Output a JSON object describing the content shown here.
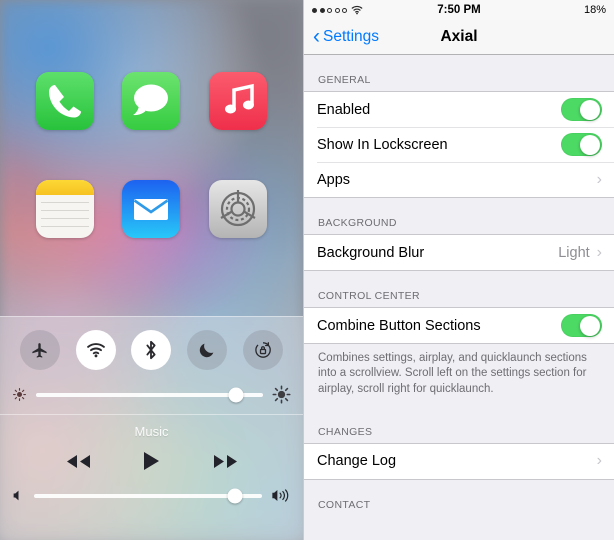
{
  "left_screen": {
    "name": "ios-home-screen",
    "apps": [
      {
        "name": "phone-app-icon",
        "label": "Phone"
      },
      {
        "name": "messages-app-icon",
        "label": "Messages"
      },
      {
        "name": "music-app-icon",
        "label": "Music"
      },
      {
        "name": "notes-app-icon",
        "label": "Notes"
      },
      {
        "name": "mail-app-icon",
        "label": "Mail"
      },
      {
        "name": "settings-app-icon",
        "label": "Settings"
      }
    ],
    "control_center": {
      "toggles": [
        {
          "name": "airplane-mode-toggle",
          "label": "Airplane Mode",
          "active": false
        },
        {
          "name": "wifi-toggle",
          "label": "Wi-Fi",
          "active": true
        },
        {
          "name": "bluetooth-toggle",
          "label": "Bluetooth",
          "active": true
        },
        {
          "name": "do-not-disturb-toggle",
          "label": "Do Not Disturb",
          "active": false
        },
        {
          "name": "rotation-lock-toggle",
          "label": "Rotation Lock",
          "active": false
        }
      ],
      "brightness": {
        "label": "Brightness",
        "value": 88
      },
      "music": {
        "title": "Music",
        "buttons": [
          {
            "name": "rewind-button",
            "label": "Rewind"
          },
          {
            "name": "play-button",
            "label": "Play"
          },
          {
            "name": "forward-button",
            "label": "Fast Forward"
          }
        ],
        "volume": {
          "label": "Volume",
          "value": 88
        }
      }
    }
  },
  "right_screen": {
    "status_bar": {
      "signal_filled": 2,
      "signal_total": 5,
      "wifi": "wifi-icon",
      "time": "7:50 PM",
      "battery": "18%"
    },
    "nav": {
      "back_label": "Settings",
      "title": "Axial",
      "accent": "#007AFF"
    },
    "sections": [
      {
        "header": "GENERAL",
        "rows": [
          {
            "label": "Enabled",
            "type": "switch",
            "value": "on"
          },
          {
            "label": "Show In Lockscreen",
            "type": "switch",
            "value": "on"
          },
          {
            "label": "Apps",
            "type": "disclosure",
            "value": ""
          }
        ],
        "footer": ""
      },
      {
        "header": "BACKGROUND",
        "rows": [
          {
            "label": "Background Blur",
            "type": "disclosure",
            "value": "Light"
          }
        ],
        "footer": ""
      },
      {
        "header": "CONTROL CENTER",
        "rows": [
          {
            "label": "Combine Button Sections",
            "type": "switch",
            "value": "on"
          }
        ],
        "footer": "Combines settings, airplay, and quicklaunch sections into a scrollview. Scroll left on the settings section for airplay, scroll right for quicklaunch."
      },
      {
        "header": "CHANGES",
        "rows": [
          {
            "label": "Change Log",
            "type": "disclosure",
            "value": ""
          }
        ],
        "footer": ""
      },
      {
        "header": "CONTACT",
        "rows": [],
        "footer": ""
      }
    ],
    "colors": {
      "switch_on": "#4CD964",
      "group_bg": "#FFFFFF",
      "page_bg": "#EFEFF4",
      "header_text": "#6D6D72"
    }
  }
}
